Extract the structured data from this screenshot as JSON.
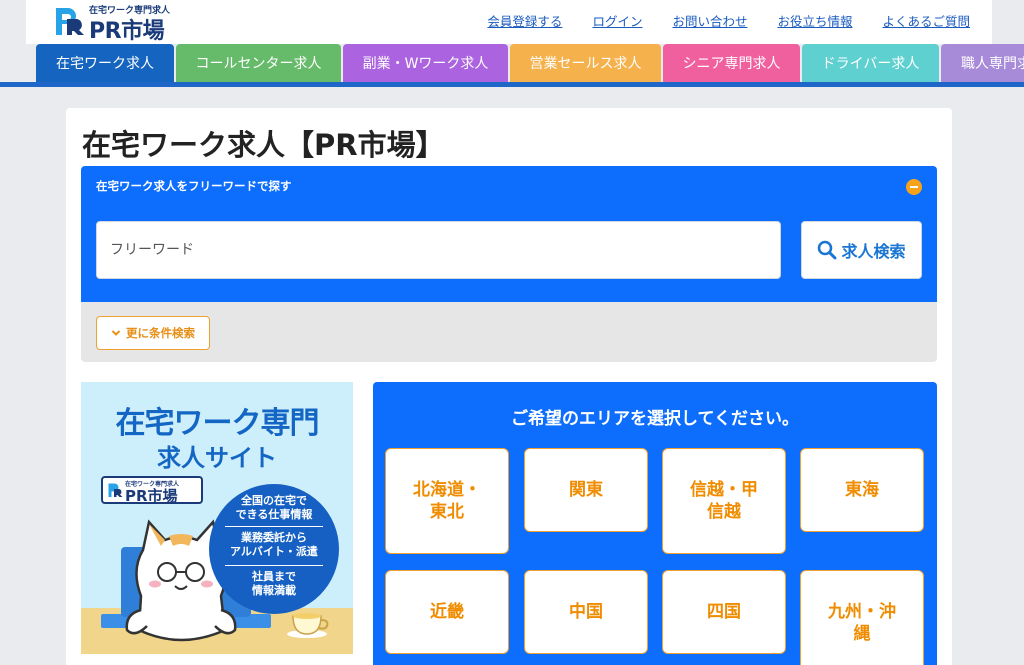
{
  "header": {
    "logo_sub": "在宅ワーク専門求人",
    "logo_main": "PR市場",
    "links": [
      "会員登録する",
      "ログイン",
      "お問い合わせ",
      "お役立ち情報",
      "よくあるご質問"
    ]
  },
  "nav": {
    "tabs": [
      {
        "label": "在宅ワーク求人",
        "color": "#1565c0"
      },
      {
        "label": "コールセンター求人",
        "color": "#66bb6a"
      },
      {
        "label": "副業・Wワーク求人",
        "color": "#ab63e0"
      },
      {
        "label": "営業セールス求人",
        "color": "#f5b14c"
      },
      {
        "label": "シニア専門求人",
        "color": "#f0609e"
      },
      {
        "label": "ドライバー求人",
        "color": "#5fd0d0"
      },
      {
        "label": "職人専門求",
        "color": "#a78bd8"
      }
    ]
  },
  "page": {
    "title": "在宅ワーク求人【PR市場】"
  },
  "search": {
    "heading": "在宅ワーク求人をフリーワードで探す",
    "placeholder": "フリーワード",
    "button_label": "求人検索",
    "more_label": "更に条件検索"
  },
  "banner": {
    "line1": "在宅ワーク専門",
    "line2": "求人サイト",
    "logo_sub": "在宅ワーク専門求人",
    "logo_main": "PR市場",
    "circle_1a": "全国の在宅で",
    "circle_1b": "できる仕事情報",
    "circle_2a": "業務委託から",
    "circle_2b": "アルバイト・派遣",
    "circle_3a": "社員まで",
    "circle_3b": "情報満載"
  },
  "areas": {
    "heading": "ご希望のエリアを選択してください。",
    "items": [
      {
        "line1": "北海道・",
        "line2": "東北"
      },
      {
        "line1": "関東",
        "line2": ""
      },
      {
        "line1": "信越・甲",
        "line2": "信越"
      },
      {
        "line1": "東海",
        "line2": ""
      },
      {
        "line1": "近畿",
        "line2": ""
      },
      {
        "line1": "中国",
        "line2": ""
      },
      {
        "line1": "四国",
        "line2": ""
      },
      {
        "line1": "九州・沖",
        "line2": "縄"
      }
    ]
  },
  "colors": {
    "primary_blue": "#0d6efd",
    "accent_orange": "#f08c00",
    "link_blue": "#1a5bbf"
  }
}
